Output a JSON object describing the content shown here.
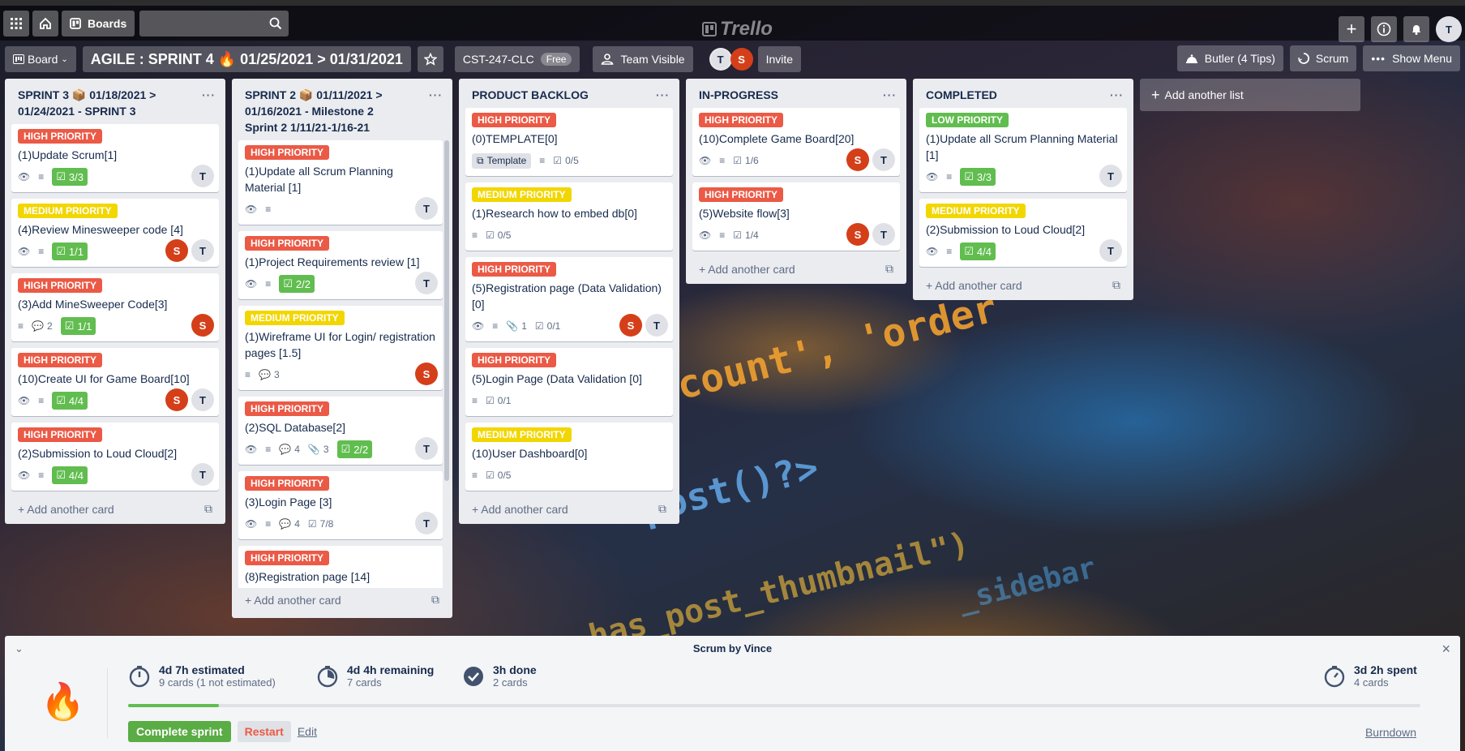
{
  "header": {
    "boards_label": "Boards",
    "logo": "Trello",
    "user_initial": "T"
  },
  "board": {
    "view_label": "Board",
    "title": "AGILE : SPRINT 4 🔥 01/25/2021 > 01/31/2021",
    "team_name": "CST-247-CLC",
    "team_plan": "Free",
    "visibility": "Team Visible",
    "members": [
      "T",
      "S"
    ],
    "invite_label": "Invite",
    "butler_label": "Butler (4 Tips)",
    "scrum_label": "Scrum",
    "show_menu_label": "Show Menu",
    "add_list_label": "Add another list",
    "add_card_label": "Add another card"
  },
  "lists": [
    {
      "title": "SPRINT 3 📦 01/18/2021 > 01/24/2021 - SPRINT 3",
      "cards": [
        {
          "label": "HIGH PRIORITY",
          "title": "(1)Update Scrum[1]",
          "checklist": "3/3"
        },
        {
          "label": "MEDIUM PRIORITY",
          "title": "(4)Review Minesweeper code [4]",
          "checklist": "1/1"
        },
        {
          "label": "HIGH PRIORITY",
          "title": "(3)Add MineSweeper Code[3]",
          "comments": "2",
          "checklist": "1/1"
        },
        {
          "label": "HIGH PRIORITY",
          "title": "(10)Create UI for Game Board[10]",
          "checklist": "4/4"
        },
        {
          "label": "HIGH PRIORITY",
          "title": "(2)Submission to Loud Cloud[2]",
          "checklist": "4/4"
        }
      ]
    },
    {
      "title": "SPRINT 2 📦 01/11/2021 > 01/16/2021 - Milestone 2 Sprint 2 1/11/21-1/16-21",
      "cards": [
        {
          "label": "HIGH PRIORITY",
          "title": "(1)Update all Scrum Planning Material [1]"
        },
        {
          "label": "HIGH PRIORITY",
          "title": "(1)Project Requirements review [1]",
          "checklist": "2/2"
        },
        {
          "label": "MEDIUM PRIORITY",
          "title": "(1)Wireframe UI for Login/ registration pages [1.5]",
          "comments": "3"
        },
        {
          "label": "HIGH PRIORITY",
          "title": "(2)SQL Database[2]",
          "comments": "4",
          "attachments": "3",
          "checklist": "2/2"
        },
        {
          "label": "HIGH PRIORITY",
          "title": "(3)Login Page [3]",
          "comments": "4",
          "checklist": "7/8"
        },
        {
          "label": "HIGH PRIORITY",
          "title": "(8)Registration page [14]"
        }
      ]
    },
    {
      "title": "PRODUCT BACKLOG",
      "cards": [
        {
          "label": "HIGH PRIORITY",
          "title": "(0)TEMPLATE[0]",
          "template": "Template",
          "checklist": "0/5"
        },
        {
          "label": "MEDIUM PRIORITY",
          "title": "(1)Research how to embed db[0]",
          "checklist": "0/5"
        },
        {
          "label": "HIGH PRIORITY",
          "title": "(5)Registration page (Data Validation) [0]",
          "attachments": "1",
          "checklist": "0/1"
        },
        {
          "label": "HIGH PRIORITY",
          "title": "(5)Login Page (Data Validation [0]",
          "checklist": "0/1"
        },
        {
          "label": "MEDIUM PRIORITY",
          "title": "(10)User Dashboard[0]",
          "checklist": "0/5"
        }
      ]
    },
    {
      "title": "IN-PROGRESS",
      "cards": [
        {
          "label": "HIGH PRIORITY",
          "title": "(10)Complete Game Board[20]",
          "checklist": "1/6"
        },
        {
          "label": "HIGH PRIORITY",
          "title": "(5)Website flow[3]",
          "checklist": "1/4"
        }
      ]
    },
    {
      "title": "COMPLETED",
      "cards": [
        {
          "label": "LOW PRIORITY",
          "title": "(1)Update all Scrum Planning Material [1]",
          "checklist": "3/3"
        },
        {
          "label": "MEDIUM PRIORITY",
          "title": "(2)Submission to Loud Cloud[2]",
          "checklist": "4/4"
        }
      ]
    }
  ],
  "scrum": {
    "title": "Scrum by Vince",
    "estimated": "4d 7h estimated",
    "estimated_sub": "9 cards (1 not estimated)",
    "remaining": "4d 4h remaining",
    "remaining_sub": "7 cards",
    "done": "3h done",
    "done_sub": "2 cards",
    "spent": "3d 2h spent",
    "spent_sub": "4 cards",
    "progress_fraction": 0.07,
    "complete_label": "Complete sprint",
    "restart_label": "Restart",
    "edit_label": "Edit",
    "burndown_label": "Burndown"
  },
  "background_code": [
    "count', 'order",
    "post()?>",
    "has_post_thumbnail\")",
    "_sidebar"
  ],
  "colors": {
    "high": "#eb5a46",
    "medium": "#f2d600",
    "low": "#61bd4f",
    "member_s": "#d43f19"
  }
}
